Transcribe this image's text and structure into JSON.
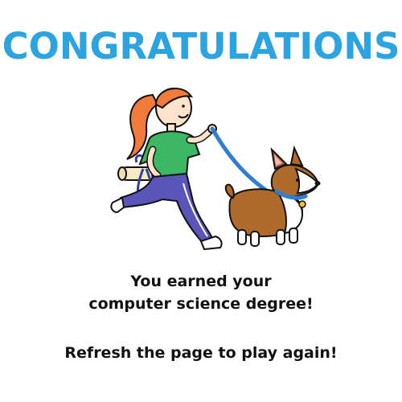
{
  "screen": {
    "headline": "CONGRATULATIONS",
    "message_line_1": "You earned your",
    "message_line_2": "computer science degree!",
    "replay_text": "Refresh the page to play again!"
  },
  "colors": {
    "headline": "#2ba4e0",
    "text": "#111111",
    "background": "#ffffff",
    "leash": "#2f7fd0",
    "shirt": "#3cb763",
    "pants": "#5a55b8",
    "hair": "#f07b3a",
    "dog": "#b06a2c"
  },
  "illustration": {
    "subject": "woman-walking-corgi-with-diploma"
  }
}
